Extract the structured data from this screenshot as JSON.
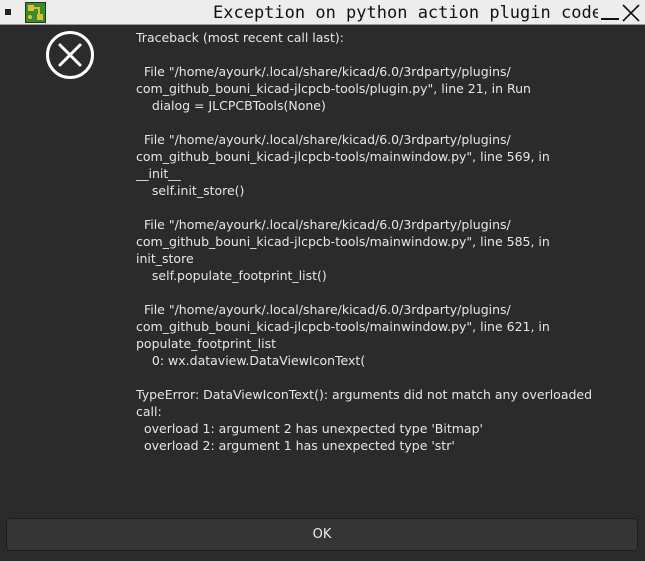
{
  "window": {
    "title": "Exception on python action plugin code"
  },
  "icons": {
    "menu": "window-menu-icon",
    "app": "kicad-pcb-icon",
    "minimize": "minimize-icon",
    "close": "close-icon",
    "error": "error-circle-x-icon"
  },
  "message": {
    "text": "Traceback (most recent call last):\n\n  File \"/home/ayourk/.local/share/kicad/6.0/3rdparty/plugins/\ncom_github_bouni_kicad-jlcpcb-tools/plugin.py\", line 21, in Run\n    dialog = JLCPCBTools(None)\n\n  File \"/home/ayourk/.local/share/kicad/6.0/3rdparty/plugins/\ncom_github_bouni_kicad-jlcpcb-tools/mainwindow.py\", line 569, in\n__init__\n    self.init_store()\n\n  File \"/home/ayourk/.local/share/kicad/6.0/3rdparty/plugins/\ncom_github_bouni_kicad-jlcpcb-tools/mainwindow.py\", line 585, in\ninit_store\n    self.populate_footprint_list()\n\n  File \"/home/ayourk/.local/share/kicad/6.0/3rdparty/plugins/\ncom_github_bouni_kicad-jlcpcb-tools/mainwindow.py\", line 621, in\npopulate_footprint_list\n    0: wx.dataview.DataViewIconText(\n\nTypeError: DataViewIconText(): arguments did not match any overloaded\ncall:\n  overload 1: argument 2 has unexpected type 'Bitmap'\n  overload 2: argument 1 has unexpected type 'str'"
  },
  "buttons": {
    "ok_label": "OK"
  },
  "colors": {
    "dialog_background": "#2b2b2b",
    "titlebar_background": "#ededed",
    "text": "#e6e6e6",
    "button_background": "#353535"
  }
}
